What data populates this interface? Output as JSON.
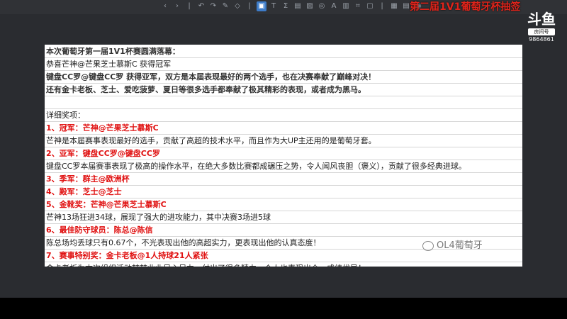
{
  "overlay_title": "第二届1V1葡萄牙杯抽签",
  "logo": {
    "room_label": "房间号",
    "room_id": "9864861"
  },
  "watermark": "OL4葡萄牙",
  "toolbar_icons": [
    "nav-left-icon",
    "nav-right-icon",
    "separator",
    "undo-icon",
    "redo-icon",
    "pen-icon",
    "eraser-icon",
    "separator",
    "slides-icon",
    "text-icon",
    "sum-icon",
    "ppt-icon",
    "image-icon",
    "drop-icon",
    "font-icon",
    "chart-icon",
    "crop-icon",
    "frame-icon",
    "separator",
    "grid-icon",
    "data-icon",
    "camera-icon"
  ],
  "rows": [
    {
      "text": "本次葡萄牙第一届1V1杯赛圆满落幕：",
      "style": "bold"
    },
    {
      "text": "恭喜芒神@芒果芝士慕斯C 获得冠军",
      "style": "normal"
    },
    {
      "text": "键盘CC罗@键盘CC罗 获得亚军，双方是本届表现最好的两个选手，也在决赛奉献了巅峰对决！",
      "style": "bold"
    },
    {
      "text": "还有金卡老板、芝士、爱吃菠萝、夏日等很多选手都奉献了极其精彩的表现，或者成为黑马。",
      "style": "bold"
    },
    {
      "text": "",
      "style": "normal"
    },
    {
      "text": "详细奖项：",
      "style": "normal"
    },
    {
      "text": "1、冠军：芒神@芒果芝士慕斯C",
      "style": "red"
    },
    {
      "text": "芒神是本届赛事表现最好的选手，贡献了高超的技术水平，而且作为大UP主还用的是葡萄牙套。",
      "style": "normal"
    },
    {
      "text": "2、亚军：键盘CC罗@键盘CC罗",
      "style": "red"
    },
    {
      "text": "键盘CC罗本届赛事表现了极高的操作水平，在绝大多数比赛都成碾压之势，令人闻风丧胆（褒义），贡献了很多经典进球。",
      "style": "normal"
    },
    {
      "text": "3、季军：群主@欧洲杯",
      "style": "red"
    },
    {
      "text": "4、殿军：芝士@芝士",
      "style": "red"
    },
    {
      "text": "5、金靴奖：芒神@芒果芝士慕斯C",
      "style": "red"
    },
    {
      "text": "芒神13场狂进34球，展现了强大的进攻能力，其中决赛3场进5球",
      "style": "normal"
    },
    {
      "text": "6、最佳防守球员：陈总@陈信",
      "style": "red"
    },
    {
      "text": "陈总场均丢球只有0.67个，不光表现出他的高超实力，更表现出他的认真态度！",
      "style": "normal"
    },
    {
      "text": "7、赛事特别奖：金卡老板@1人持球21人紧张",
      "style": "red"
    },
    {
      "text": "金卡老板为本次组织活动兢兢业业尽心尽力，付出了很多精力，个人也表现出众，成绩优异！",
      "style": "normal"
    }
  ]
}
